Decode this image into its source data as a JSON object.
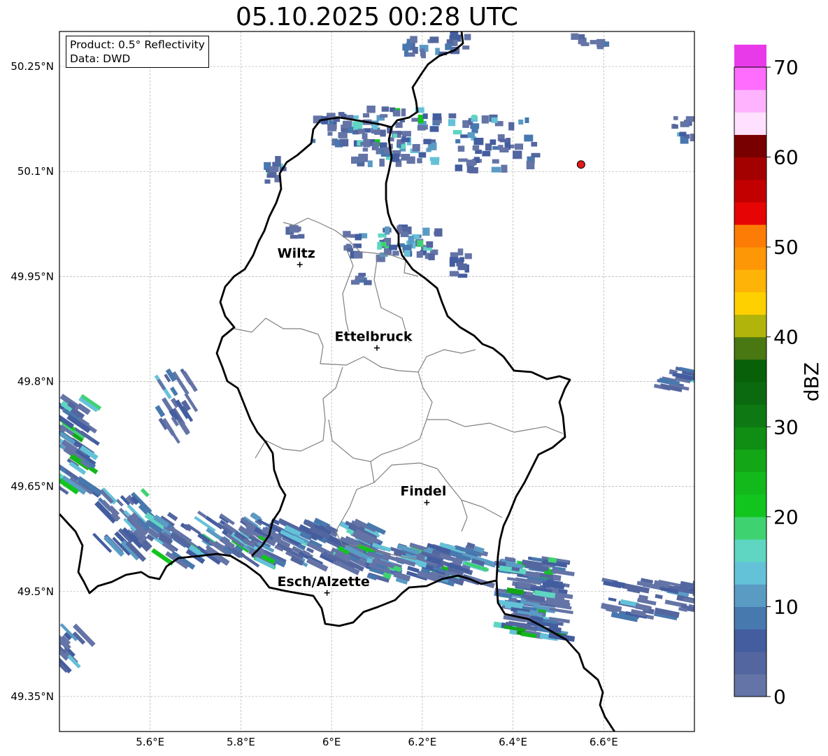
{
  "title": "05.10.2025 00:28 UTC",
  "info_box": {
    "product": "Product: 0.5° Reflectivity",
    "data": "Data: DWD"
  },
  "axes": {
    "x_ticks": [
      "5.6°E",
      "5.8°E",
      "6°E",
      "6.2°E",
      "6.4°E",
      "6.6°E"
    ],
    "y_ticks": [
      "50.25°N",
      "50.1°N",
      "49.95°N",
      "49.8°N",
      "49.65°N",
      "49.5°N",
      "49.35°N"
    ],
    "lon_range": [
      5.4,
      6.8
    ],
    "lat_range": [
      49.3,
      50.3
    ]
  },
  "cities": [
    {
      "name": "Wiltz",
      "lon": 5.93,
      "lat": 49.967
    },
    {
      "name": "Ettelbruck",
      "lon": 6.1,
      "lat": 49.848
    },
    {
      "name": "Findel",
      "lon": 6.21,
      "lat": 49.627
    },
    {
      "name": "Esch/Alzette",
      "lon": 5.99,
      "lat": 49.498
    }
  ],
  "radar_site": {
    "lon": 6.55,
    "lat": 50.11,
    "color": "#e01b1b"
  },
  "colorbar": {
    "label": "dBZ",
    "ticks": [
      "0",
      "10",
      "20",
      "30",
      "40",
      "50",
      "60",
      "70"
    ],
    "min": 0,
    "max": 70,
    "step": 2.5,
    "colors": [
      "#6474a6",
      "#54669f",
      "#435d9f",
      "#4778ae",
      "#5a9bc4",
      "#64c2d8",
      "#5ed6c2",
      "#3ed370",
      "#12c51e",
      "#13b81a",
      "#13a617",
      "#0f8e13",
      "#0e7812",
      "#0b6a10",
      "#086109",
      "#497712",
      "#b1b40a",
      "#fed000",
      "#fdb307",
      "#fd9705",
      "#fd7c05",
      "#e60404",
      "#c20000",
      "#a30000",
      "#780000",
      "#ffe1ff",
      "#ffb3ff",
      "#ff6dff",
      "#e93ae9"
    ]
  }
}
